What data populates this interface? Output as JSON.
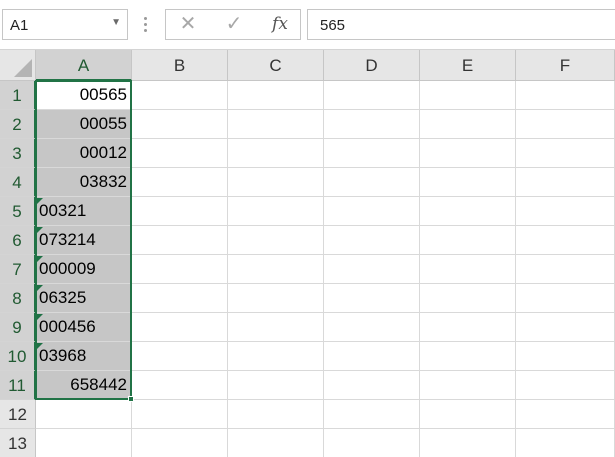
{
  "formula_bar": {
    "name_box": "A1",
    "name_box_icon": "chevron-down-icon",
    "cancel_icon": "✕",
    "enter_icon": "✓",
    "fx_label": "fx",
    "formula_value": "565"
  },
  "columns": [
    "A",
    "B",
    "C",
    "D",
    "E",
    "F"
  ],
  "rows": [
    "1",
    "2",
    "3",
    "4",
    "5",
    "6",
    "7",
    "8",
    "9",
    "10",
    "11",
    "12",
    "13"
  ],
  "column_a": [
    {
      "value": "00565",
      "align": "right",
      "text_flag": false
    },
    {
      "value": "00055",
      "align": "right",
      "text_flag": false
    },
    {
      "value": "00012",
      "align": "right",
      "text_flag": false
    },
    {
      "value": "03832",
      "align": "right",
      "text_flag": false
    },
    {
      "value": "00321",
      "align": "left",
      "text_flag": true
    },
    {
      "value": "073214",
      "align": "left",
      "text_flag": true
    },
    {
      "value": "000009",
      "align": "left",
      "text_flag": true
    },
    {
      "value": "06325",
      "align": "left",
      "text_flag": true
    },
    {
      "value": "000456",
      "align": "left",
      "text_flag": true
    },
    {
      "value": "03968",
      "align": "left",
      "text_flag": true
    },
    {
      "value": "658442",
      "align": "right",
      "text_flag": false
    }
  ],
  "colors": {
    "selection_border": "#217346",
    "selection_fill": "#c6c6c6",
    "error_indicator": "#1e7145"
  }
}
